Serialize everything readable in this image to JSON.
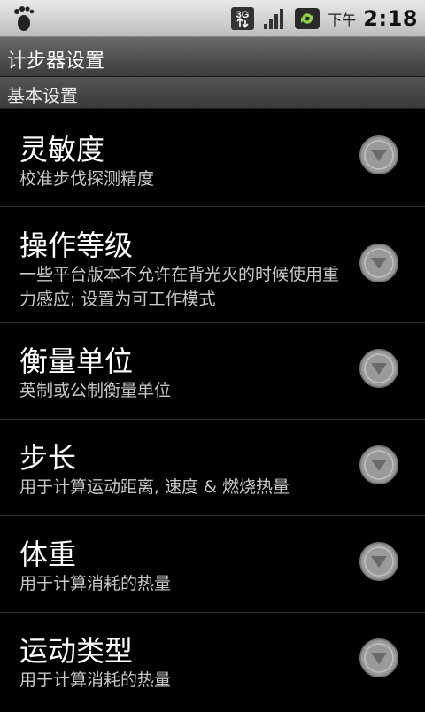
{
  "status_bar": {
    "app_icon": "footprint-icon",
    "network_label": "3G",
    "time_ampm": "下午",
    "time": "2:18"
  },
  "title_bar": {
    "title": "计步器设置"
  },
  "category": {
    "label": "基本设置"
  },
  "preferences": [
    {
      "title": "灵敏度",
      "summary": "校准步伐探测精度"
    },
    {
      "title": "操作等级",
      "summary": "一些平台版本不允许在背光灭的时候使用重力感应; 设置为可工作模式"
    },
    {
      "title": "衡量单位",
      "summary": "英制或公制衡量单位"
    },
    {
      "title": "步长",
      "summary": "用于计算运动距离, 速度 & 燃烧热量"
    },
    {
      "title": "体重",
      "summary": "用于计算消耗的热量"
    },
    {
      "title": "运动类型",
      "summary": "用于计算消耗的热量"
    }
  ],
  "colors": {
    "background": "#000000",
    "summary_text": "#c8c8c8",
    "chevron": "#9a9a9a"
  }
}
